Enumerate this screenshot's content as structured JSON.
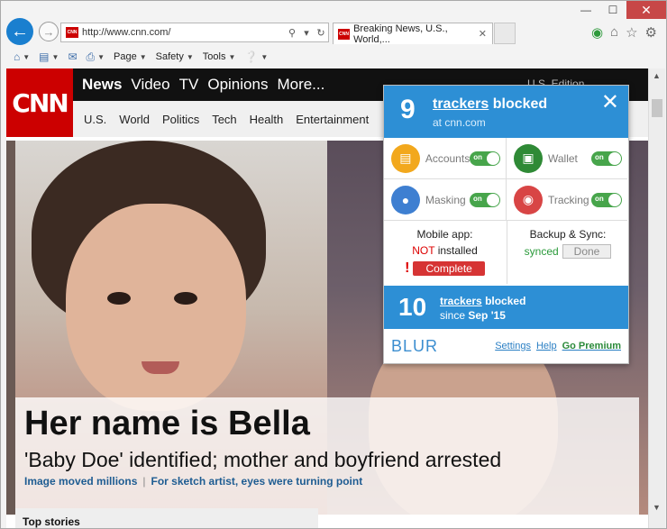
{
  "browser": {
    "url": "http://www.cnn.com/",
    "tab_title": "Breaking News, U.S., World,...",
    "favicon_text": "CNN",
    "window_controls": {
      "minimize": "—",
      "maximize": "☐",
      "close": "✕"
    },
    "command_bar": [
      "Page",
      "Safety",
      "Tools"
    ]
  },
  "cnn": {
    "logo": "CNN",
    "main_nav": [
      "News",
      "Video",
      "TV",
      "Opinions",
      "More..."
    ],
    "edition": "U.S. Edition",
    "sub_nav": [
      "U.S.",
      "World",
      "Politics",
      "Tech",
      "Health",
      "Entertainment"
    ],
    "headline": "Her name is Bella",
    "subhead": "'Baby Doe' identified; mother and boyfriend arrested",
    "links": [
      "Image moved millions",
      "For sketch artist, eyes were turning point"
    ],
    "link_separator": "|",
    "top_stories": "Top stories"
  },
  "blur": {
    "count": "9",
    "trackers_word": "trackers",
    "blocked_word": "blocked",
    "site": "at cnn.com",
    "close_icon": "✕",
    "features": [
      {
        "label": "Accounts",
        "state": "on",
        "color": "#f2a81d"
      },
      {
        "label": "Wallet",
        "state": "on",
        "color": "#2f8a36"
      },
      {
        "label": "Masking",
        "state": "on",
        "color": "#3e7fd1"
      },
      {
        "label": "Tracking",
        "state": "on",
        "color": "#d84545"
      }
    ],
    "mobile": {
      "title": "Mobile app:",
      "status_red": "NOT",
      "status_rest": " installed",
      "bang": "!",
      "button": "Complete"
    },
    "backup": {
      "title": "Backup & Sync:",
      "status": "synced",
      "button": "Done"
    },
    "total": {
      "count": "10",
      "trackers_word": "trackers",
      "blocked_word": "blocked",
      "since_prefix": "since",
      "since_value": "Sep '15"
    },
    "brand": "BLUR",
    "footer_links": [
      "Settings",
      "Help",
      "Go Premium"
    ]
  }
}
